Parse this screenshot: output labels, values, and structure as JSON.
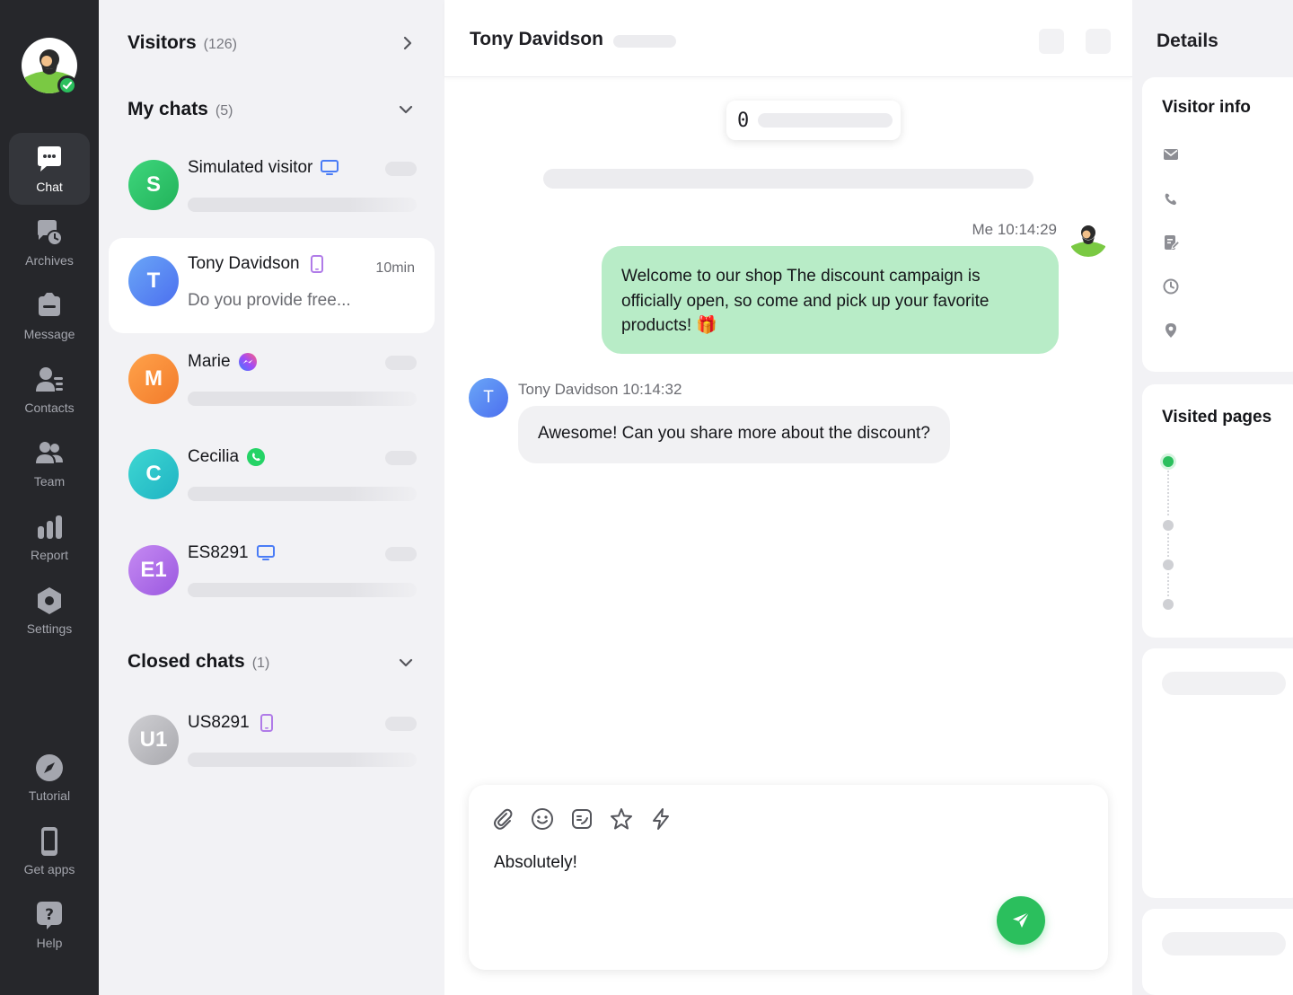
{
  "nav": {
    "items": [
      {
        "label": "Chat",
        "icon": "chat-bubble-icon"
      },
      {
        "label": "Archives",
        "icon": "archive-icon"
      },
      {
        "label": "Message",
        "icon": "message-icon"
      },
      {
        "label": "Contacts",
        "icon": "contacts-icon"
      },
      {
        "label": "Team",
        "icon": "team-icon"
      },
      {
        "label": "Report",
        "icon": "report-icon"
      },
      {
        "label": "Settings",
        "icon": "settings-icon"
      }
    ],
    "bottom": [
      {
        "label": "Tutorial",
        "icon": "compass-icon"
      },
      {
        "label": "Get apps",
        "icon": "phone-icon"
      },
      {
        "label": "Help",
        "icon": "help-icon"
      }
    ]
  },
  "list": {
    "visitors_title": "Visitors",
    "visitors_count": "(126)",
    "mychats_title": "My chats",
    "mychats_count": "(5)",
    "closed_title": "Closed chats",
    "closed_count": "(1)",
    "chats": [
      {
        "initial": "S",
        "name": "Simulated visitor",
        "channel": "desktop-icon"
      },
      {
        "initial": "T",
        "name": "Tony Davidson",
        "channel": "mobile-icon",
        "time": "10min",
        "preview": "Do you provide free..."
      },
      {
        "initial": "M",
        "name": "Marie",
        "channel": "messenger-icon"
      },
      {
        "initial": "C",
        "name": "Cecilia",
        "channel": "whatsapp-icon"
      },
      {
        "initial": "E1",
        "name": "ES8291",
        "channel": "desktop-icon"
      }
    ],
    "closed": [
      {
        "initial": "U1",
        "name": "US8291",
        "channel": "mobile-icon"
      }
    ]
  },
  "conversation": {
    "title": "Tony Davidson",
    "counter": "0",
    "me_meta": "Me 10:14:29",
    "me_message": "Welcome to our shop The discount campaign is officially open, so come and pick up your favorite products! 🎁",
    "visitor_initial": "T",
    "visitor_meta": "Tony Davidson 10:14:32",
    "visitor_message": "Awesome! Can you share more about the discount?",
    "composer_text": "Absolutely!"
  },
  "details": {
    "title": "Details",
    "visitor_info_title": "Visitor info",
    "visited_pages_title": "Visited pages"
  },
  "colors": {
    "accent_green": "#2bbf5d",
    "my_bubble": "#b8ecc7",
    "nav_bg": "#26272b"
  }
}
